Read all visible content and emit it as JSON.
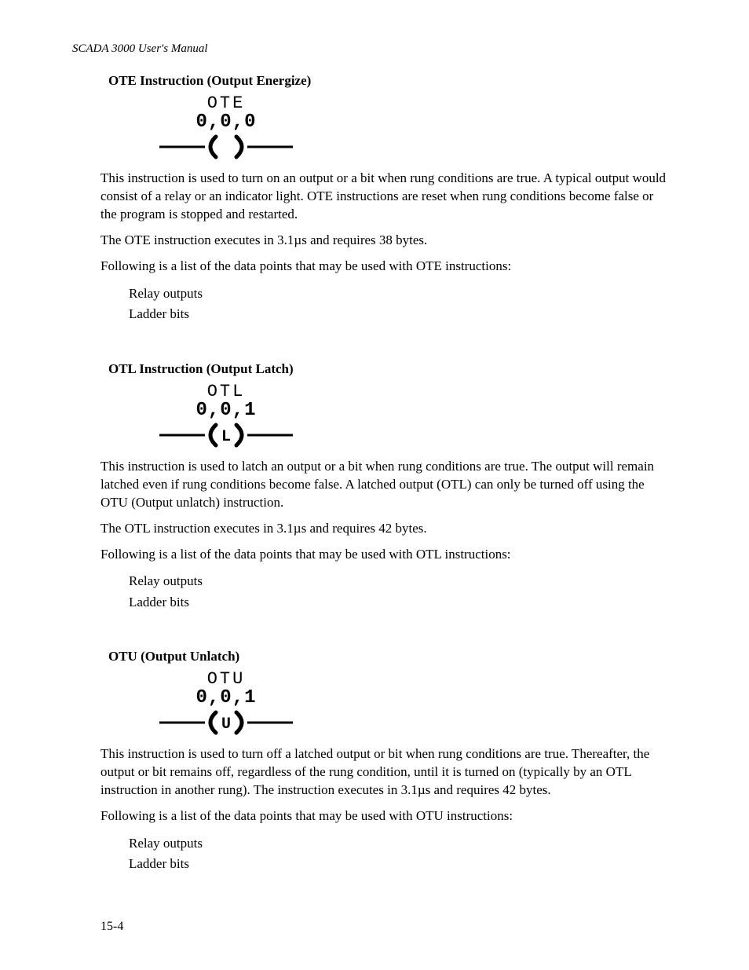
{
  "running_head": "SCADA 3000 User's Manual",
  "page_number": "15-4",
  "sections": [
    {
      "heading": "OTE Instruction  (Output Energize)",
      "diagram": {
        "line1": "OTE",
        "line2": "0,0,0",
        "inner": ""
      },
      "paragraphs": [
        "This instruction is used to turn on an output or a bit when rung conditions are true. A typical output would consist of a relay or an indicator light. OTE instructions are reset when rung conditions become false or the program is stopped and restarted.",
        "The OTE instruction executes in 3.1µs and requires 38 bytes.",
        "Following is a list of the data points that may be used with OTE instructions:"
      ],
      "list": [
        "Relay outputs",
        "Ladder bits"
      ]
    },
    {
      "heading": "OTL Instruction  (Output Latch)",
      "diagram": {
        "line1": "OTL",
        "line2": "0,0,1",
        "inner": "L"
      },
      "paragraphs": [
        "This instruction is used to latch an output or a bit when rung conditions are true. The output will remain latched even if rung conditions become false. A latched output (OTL) can only be turned off using the OTU (Output unlatch) instruction.",
        "The OTL instruction executes in 3.1µs and requires 42 bytes.",
        "Following is a list of the data points that may be used with OTL instructions:"
      ],
      "list": [
        "Relay outputs",
        "Ladder bits"
      ]
    },
    {
      "heading": "OTU  (Output Unlatch)",
      "diagram": {
        "line1": "OTU",
        "line2": "0,0,1",
        "inner": "U"
      },
      "paragraphs": [
        "This instruction is used to turn off a latched output or bit when rung conditions are true. Thereafter, the output or bit remains off, regardless of the rung condition, until it is turned on (typically by an OTL instruction in another rung). The instruction executes in 3.1µs and requires 42 bytes.",
        "Following is a list of the data points that may be used with OTU instructions:"
      ],
      "list": [
        "Relay outputs",
        "Ladder bits"
      ]
    }
  ]
}
